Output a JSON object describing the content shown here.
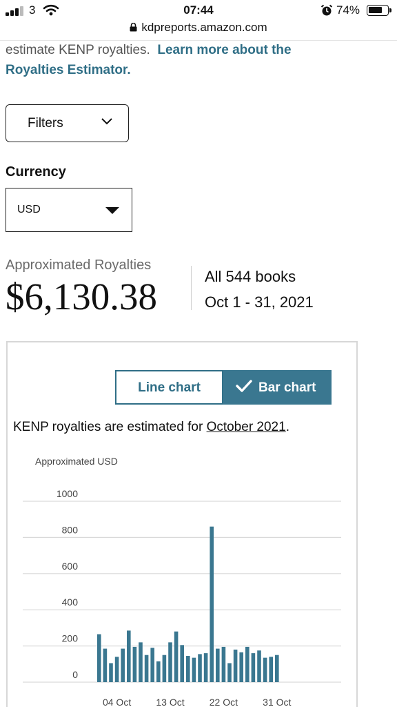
{
  "status_bar": {
    "carrier": "3",
    "time": "07:44",
    "battery": "74%",
    "battery_level": 0.74
  },
  "browser": {
    "url": "kdpreports.amazon.com"
  },
  "intro": {
    "text": "estimate KENP royalties.",
    "link_line1": "Learn more about the",
    "link_line2": "Royalties Estimator."
  },
  "filters": {
    "label": "Filters"
  },
  "currency": {
    "label": "Currency",
    "value": "USD"
  },
  "royalties": {
    "label": "Approximated Royalties",
    "amount": "$6,130.38",
    "books": "All 544 books",
    "date_range": "Oct 1 - 31, 2021"
  },
  "chart_toggle": {
    "line_label": "Line chart",
    "bar_label": "Bar chart",
    "selected": "bar"
  },
  "note": {
    "prefix": "KENP royalties are estimated for",
    "month": "October 2021",
    "suffix": "."
  },
  "colors": {
    "accent": "#2f6e86",
    "bar": "#3a7790",
    "grid": "#d9d9d9"
  },
  "icons": [
    "signal-icon",
    "wifi-icon",
    "alarm-icon",
    "battery-icon",
    "lock-icon",
    "chevron-down-icon",
    "caret-down-icon",
    "check-icon"
  ],
  "chart_data": {
    "type": "bar",
    "ylabel": "Approximated USD",
    "ylim": [
      0,
      1000
    ],
    "yticks": [
      0,
      200,
      400,
      600,
      800,
      1000
    ],
    "grid": true,
    "x_tick_labels": [
      {
        "label": "04 Oct",
        "day": 4
      },
      {
        "label": "13 Oct",
        "day": 13
      },
      {
        "label": "22 Oct",
        "day": 22
      },
      {
        "label": "31 Oct",
        "day": 31
      }
    ],
    "categories": [
      "Oct 1",
      "Oct 2",
      "Oct 3",
      "Oct 4",
      "Oct 5",
      "Oct 6",
      "Oct 7",
      "Oct 8",
      "Oct 9",
      "Oct 10",
      "Oct 11",
      "Oct 12",
      "Oct 13",
      "Oct 14",
      "Oct 15",
      "Oct 16",
      "Oct 17",
      "Oct 18",
      "Oct 19",
      "Oct 20",
      "Oct 21",
      "Oct 22",
      "Oct 23",
      "Oct 24",
      "Oct 25",
      "Oct 26",
      "Oct 27",
      "Oct 28",
      "Oct 29",
      "Oct 30",
      "Oct 31",
      "Nov 1"
    ],
    "values": [
      265,
      185,
      105,
      140,
      185,
      285,
      195,
      220,
      150,
      190,
      115,
      150,
      220,
      280,
      205,
      145,
      135,
      155,
      160,
      860,
      185,
      195,
      105,
      180,
      165,
      195,
      160,
      175,
      135,
      140,
      150,
      0
    ]
  }
}
